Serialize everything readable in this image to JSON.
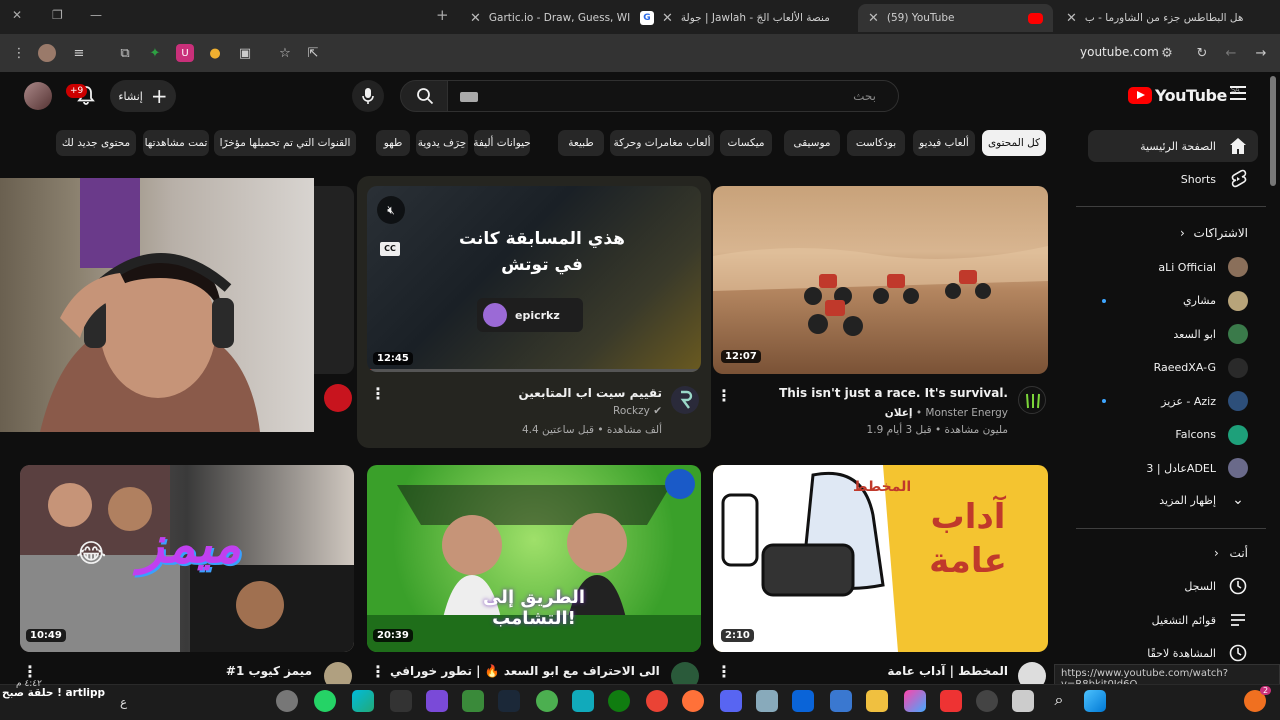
{
  "browser": {
    "tabs": [
      {
        "title": "هل البطاطس جزء من الشاورما - ب",
        "fav_color": "#4285f4"
      },
      {
        "title": "(59) YouTube",
        "fav_color": "#ff0000"
      },
      {
        "title": "جولة | Jawlah - منصة الألعاب الجَ",
        "fav_color": "#3c8cff"
      },
      {
        "title": "Gartic.io - Draw, Guess, WIN",
        "fav_color": "#ff9a2e"
      }
    ],
    "new_tab": "+",
    "url": "youtube.com"
  },
  "yt": {
    "logo_text": "YouTube",
    "region": "SA",
    "search_placeholder": "بحث",
    "create_label": "إنشاء",
    "notif_count": "+9"
  },
  "chips": [
    "كل المحتوى",
    "ألعاب فيديو",
    "بودكاست",
    "موسيقى",
    "ميكسات",
    "ألعاب مغامرات وحركة",
    "طبيعة",
    "حيوانات أليفة",
    "حِرَف يدوية",
    "طهو",
    "القنوات التي تم تحميلها مؤخرًا",
    "تمت مشاهدتها",
    "محتوى جديد لك"
  ],
  "sidebar": {
    "home": "الصفحة الرئيسية",
    "shorts": "Shorts",
    "subs_header": "الاشتراكات",
    "subs": [
      {
        "name": "aLi Official",
        "color": "#8a6f5a",
        "dot": false
      },
      {
        "name": "مشاري",
        "color": "#b8a47a",
        "dot": true
      },
      {
        "name": "ابو السعد",
        "color": "#3a7a4a",
        "dot": false
      },
      {
        "name": "RaeedXA-G",
        "color": "#2a2a2a",
        "dot": false
      },
      {
        "name": "عزيز - Aziz",
        "color": "#2d4f7a",
        "dot": true
      },
      {
        "name": "Falcons",
        "color": "#1ea07a",
        "dot": false
      },
      {
        "name": "عادل | 3ADEL",
        "color": "#6a6a8a",
        "dot": false
      }
    ],
    "show_more": "إظهار المزيد",
    "you_header": "أنت",
    "you": [
      "السجل",
      "قوائم التشغيل",
      "المشاهدة لاحقًا"
    ]
  },
  "videos": [
    {
      "title": "This isn't just a race. It's survival.",
      "channel": "Monster Energy",
      "meta": "1.9 مليون مشاهدة • قبل 3 أيام",
      "ad": "إعلان",
      "duration": "12:07"
    },
    {
      "title": "تقييم سيت اب المتابعين",
      "channel": "Rockzy",
      "meta": "4.4 ألف مشاهدة • قبل ساعتين",
      "duration": "12:45",
      "overlay_text": "هذي المسابقة كانت في توتش",
      "overlay_tag": "epicrkz",
      "cc": "CC"
    },
    {
      "title": "",
      "channel": "",
      "meta": "",
      "duration": ""
    },
    {
      "title": "المخطط | آداب عامة",
      "duration": "2:10",
      "thumb_text": "آداب عامة",
      "thumb_tag": "المخطط"
    },
    {
      "title": "الطريق الى الاحتراف مع ابو السعد 🔥 | تطور خورافي 😍",
      "duration": "20:39",
      "thumb_text": "الطريق إلى التشامب!"
    },
    {
      "title": "#ميمز كيوب 1",
      "duration": "10:49",
      "thumb_text": "ميمز"
    }
  ],
  "status_url": "https://www.youtube.com/watch?v=R8bkjt0Jd6Q",
  "taskbar": {
    "left_text": "حلقة صبح ! artlipp",
    "time": "٤:٤٢ م",
    "lang": "ع",
    "notif": "2"
  }
}
